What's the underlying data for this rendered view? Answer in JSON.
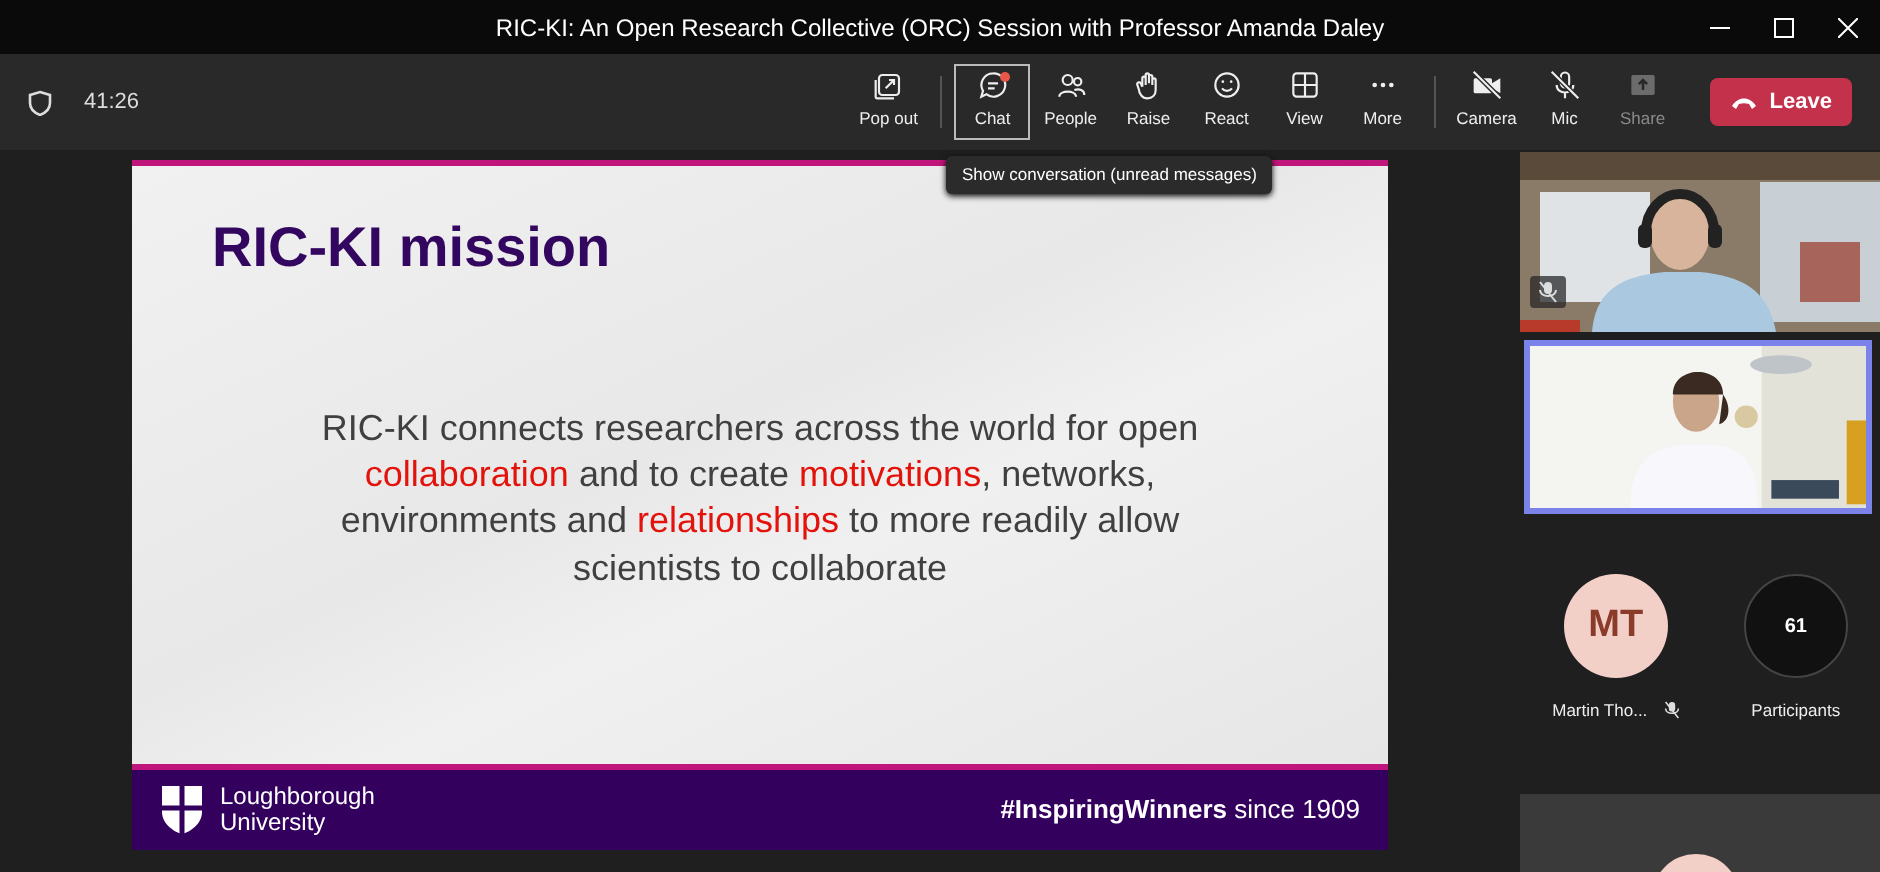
{
  "window": {
    "title": "RIC-KI: An Open Research Collective (ORC) Session with Professor Amanda Daley"
  },
  "toolbar": {
    "timer": "41:26",
    "buttons": [
      {
        "label": "Pop out",
        "selected": false,
        "unread": false,
        "off": false,
        "disabled": false
      },
      {
        "label": "Chat",
        "selected": true,
        "unread": true,
        "off": false,
        "disabled": false
      },
      {
        "label": "People",
        "selected": false,
        "unread": false,
        "off": false,
        "disabled": false
      },
      {
        "label": "Raise",
        "selected": false,
        "unread": false,
        "off": false,
        "disabled": false
      },
      {
        "label": "React",
        "selected": false,
        "unread": false,
        "off": false,
        "disabled": false
      },
      {
        "label": "View",
        "selected": false,
        "unread": false,
        "off": false,
        "disabled": false
      },
      {
        "label": "More",
        "selected": false,
        "unread": false,
        "off": false,
        "disabled": false
      },
      {
        "label": "Camera",
        "selected": false,
        "unread": false,
        "off": true,
        "disabled": false
      },
      {
        "label": "Mic",
        "selected": false,
        "unread": false,
        "off": true,
        "disabled": false
      },
      {
        "label": "Share",
        "selected": false,
        "unread": false,
        "off": false,
        "disabled": true
      }
    ],
    "leave": "Leave",
    "tooltip": "Show conversation (unread messages)"
  },
  "slide": {
    "title": "RIC-KI mission",
    "body": [
      {
        "text": "RIC-KI connects researchers across the world for open ",
        "kind": "plain"
      },
      {
        "text": "collaboration",
        "kind": "highlight"
      },
      {
        "text": " and to create ",
        "kind": "plain"
      },
      {
        "text": "motivations",
        "kind": "highlight"
      },
      {
        "text": ", networks, environments and ",
        "kind": "plain"
      },
      {
        "text": "relationships",
        "kind": "highlight"
      },
      {
        "text": " to more readily allow scientists to collaborate",
        "kind": "plain"
      }
    ],
    "logo_lines": [
      "Loughborough",
      "University"
    ],
    "tagline": "**#InspiringWinners** since 1909"
  },
  "participants": {
    "videos": [
      {
        "kind": "picture",
        "speaking": false,
        "muted": true
      },
      {
        "kind": "picture",
        "speaking": true,
        "muted": false
      }
    ],
    "people": [
      {
        "kind": "avatar",
        "initials": "MT",
        "name": "Martin Tho...",
        "muted": true
      },
      {
        "kind": "count",
        "initials": "61",
        "name": "Participants",
        "muted": false
      }
    ]
  }
}
